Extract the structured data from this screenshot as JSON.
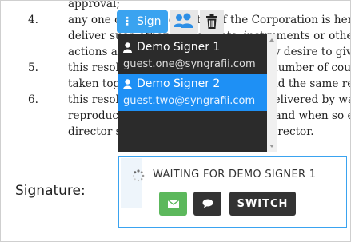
{
  "document": {
    "lines": [
      {
        "num": "",
        "text": "approval;"
      },
      {
        "num": "4.",
        "text": "any one officer or director of the Corporation is here"
      },
      {
        "num": "",
        "text": "deliver such other agreements, instruments or other"
      },
      {
        "num": "",
        "text": "actions as such officer or director may desire to give effect"
      },
      {
        "num": "5.",
        "text": "this resolution may be signed in any number of counte"
      },
      {
        "num": "",
        "text": "taken together shall constitute one and the same resol"
      },
      {
        "num": "6.",
        "text": "this resolution and any counterpart delivered by way"
      },
      {
        "num": "",
        "text": "reproducible electronic transmission and when so e"
      },
      {
        "num": "",
        "text": "director shall be binding upon such director."
      }
    ],
    "signature_label": "Signature:"
  },
  "toolbar": {
    "sign_label": "Sign",
    "users_icon": "users-icon",
    "trash_icon": "trash-icon"
  },
  "signers": [
    {
      "name": "Demo Signer 1",
      "email": "guest.one@syngrafii.com",
      "selected": false
    },
    {
      "name": "Demo Signer 2",
      "email": "guest.two@syngrafii.com",
      "selected": true
    }
  ],
  "signature_box": {
    "status": "WAITING FOR DEMO SIGNER 1",
    "confirm_icon": "envelope-icon",
    "chat_icon": "chat-icon",
    "switch_label": "SWITCH"
  },
  "colors": {
    "accent": "#3aa3f0",
    "selected": "#1e90f5",
    "dropdown_bg": "#2b2b2b",
    "confirm": "#5cb85c",
    "dark_button": "#333333"
  }
}
